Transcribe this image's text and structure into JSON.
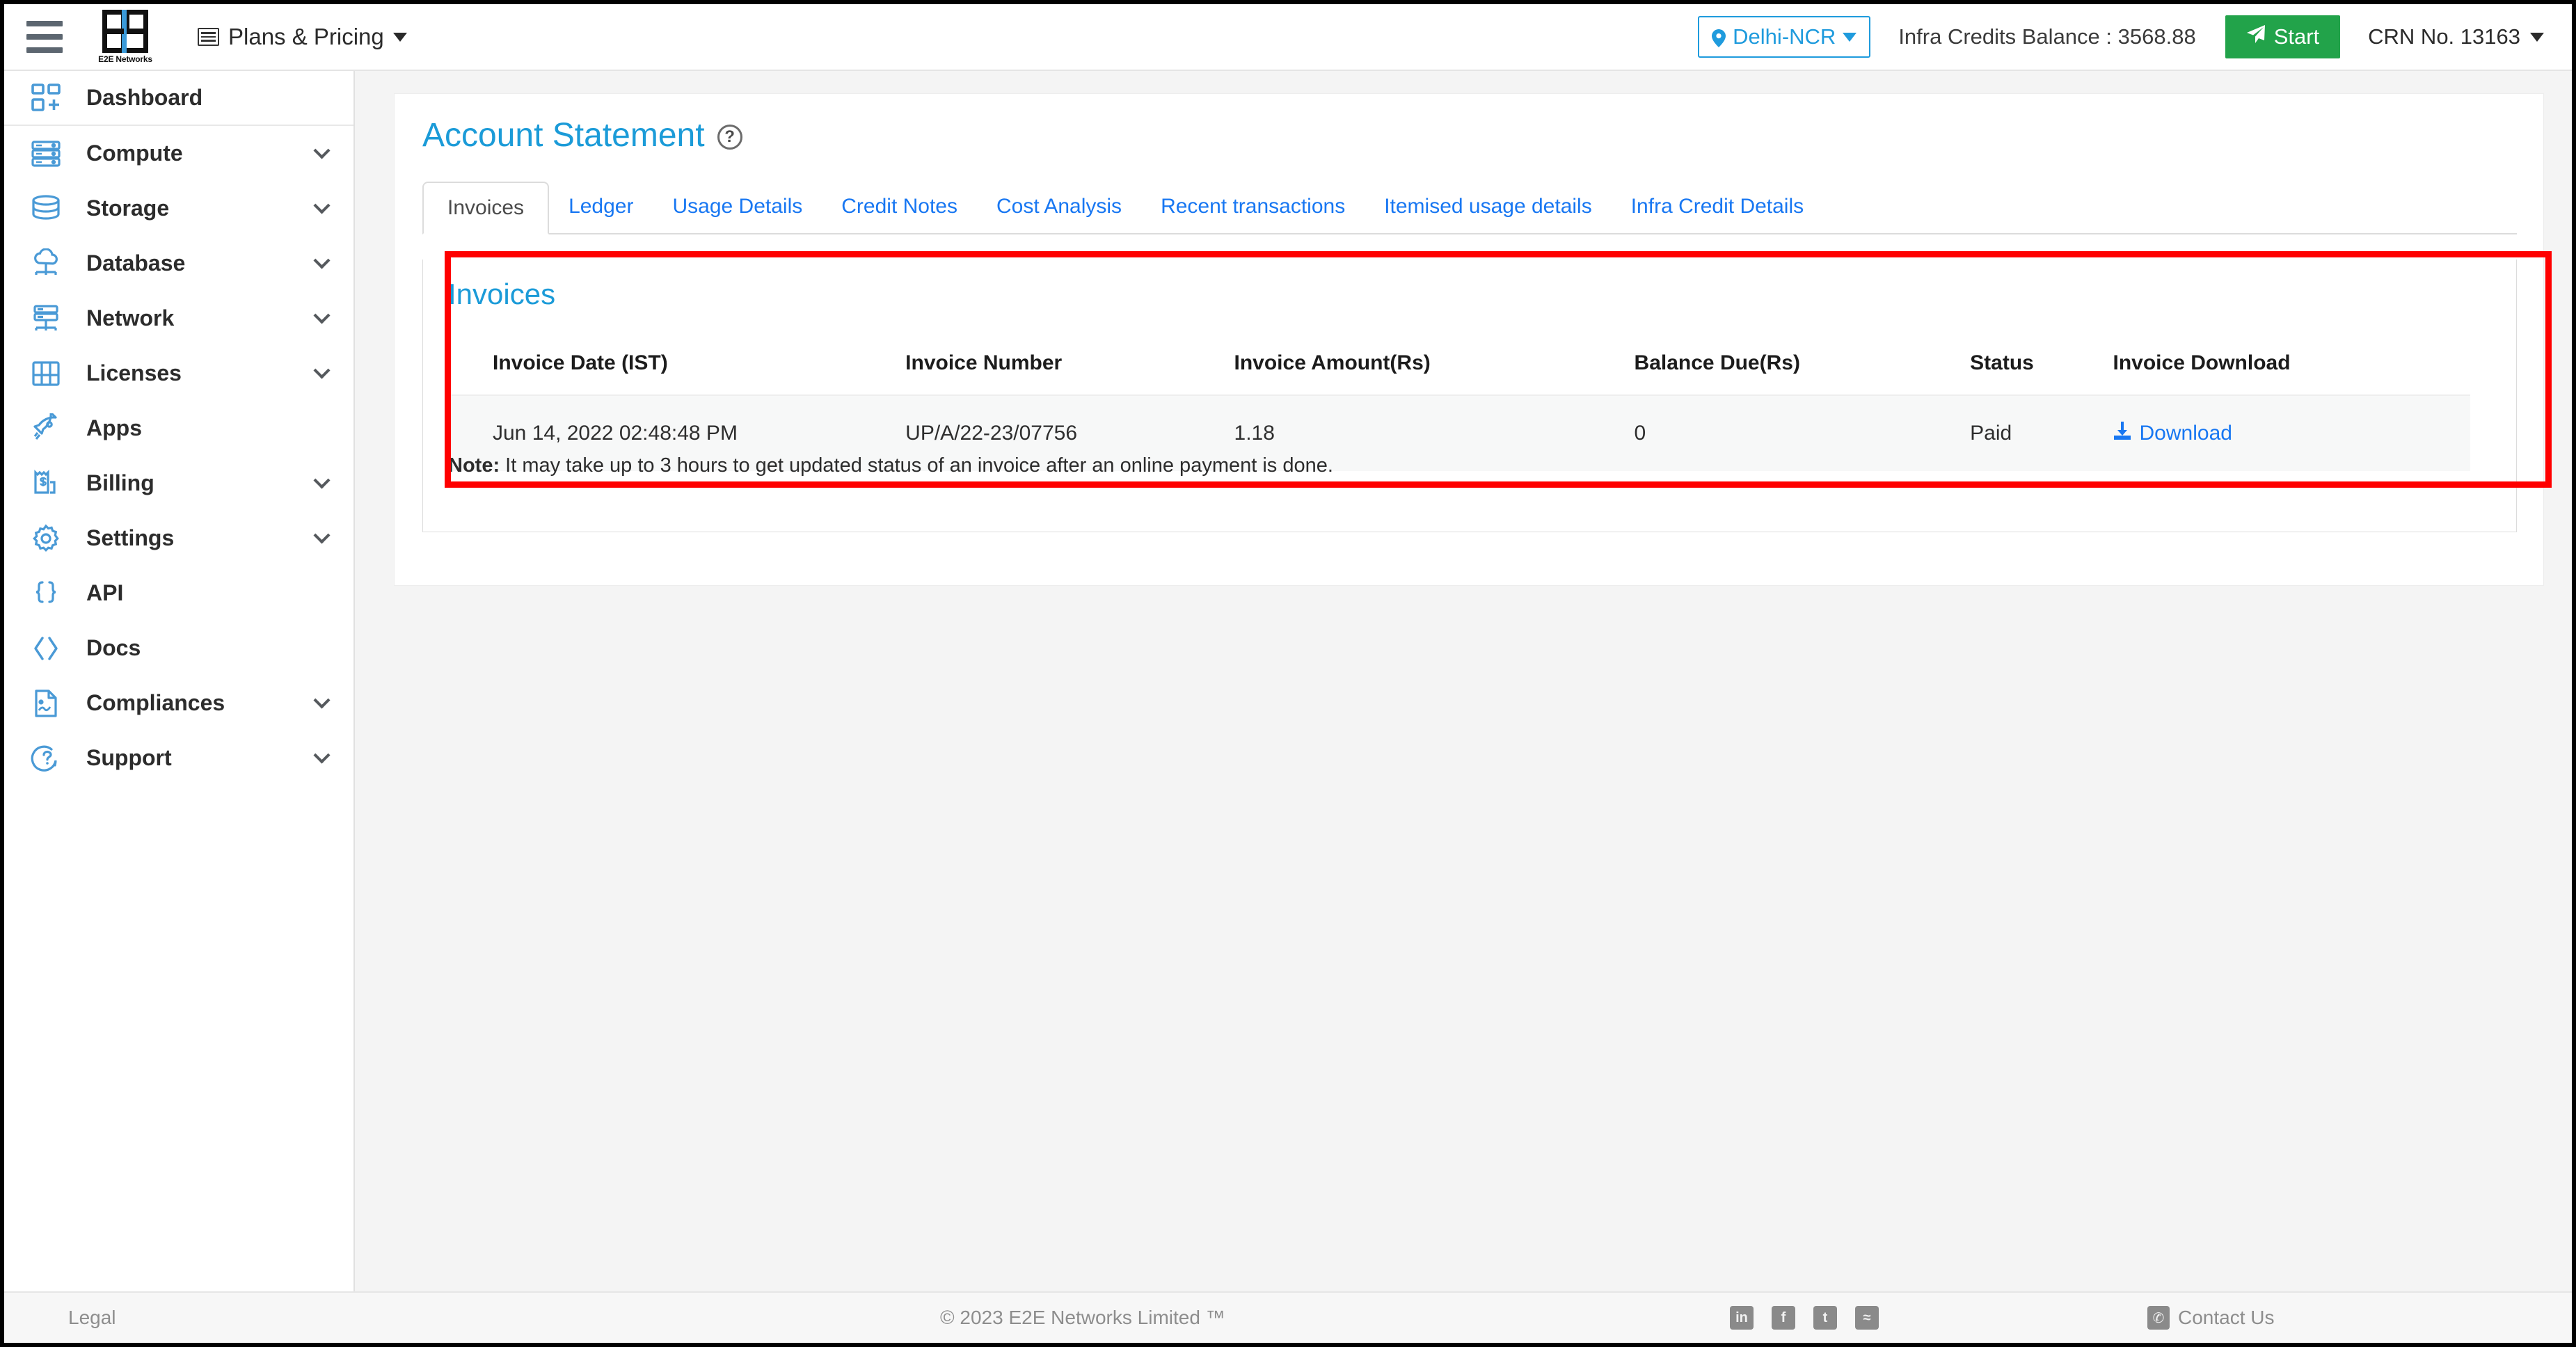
{
  "topbar": {
    "menu_icon": "hamburger-icon",
    "logo_text": "E2E Networks",
    "plans_label": "Plans & Pricing",
    "region_label": "Delhi-NCR",
    "credits_label": "Infra Credits Balance : 3568.88",
    "start_label": "Start",
    "crn_label": "CRN No. 13163"
  },
  "sidebar": {
    "items": [
      {
        "label": "Dashboard",
        "icon": "dashboard-icon",
        "chevron": false
      },
      {
        "label": "Compute",
        "icon": "server-icon",
        "chevron": true
      },
      {
        "label": "Storage",
        "icon": "database-disk-icon",
        "chevron": true
      },
      {
        "label": "Database",
        "icon": "cloud-database-icon",
        "chevron": true
      },
      {
        "label": "Network",
        "icon": "network-icon",
        "chevron": true
      },
      {
        "label": "Licenses",
        "icon": "license-grid-icon",
        "chevron": true
      },
      {
        "label": "Apps",
        "icon": "rocket-icon",
        "chevron": false
      },
      {
        "label": "Billing",
        "icon": "invoice-dollar-icon",
        "chevron": true
      },
      {
        "label": "Settings",
        "icon": "gear-icon",
        "chevron": true
      },
      {
        "label": "API",
        "icon": "braces-icon",
        "chevron": false
      },
      {
        "label": "Docs",
        "icon": "code-brackets-icon",
        "chevron": false
      },
      {
        "label": "Compliances",
        "icon": "document-icon",
        "chevron": true
      },
      {
        "label": "Support",
        "icon": "support-chat-icon",
        "chevron": true
      }
    ]
  },
  "page": {
    "title": "Account Statement",
    "help_icon": "question-circle-icon",
    "tabs": [
      {
        "label": "Invoices",
        "active": true
      },
      {
        "label": "Ledger",
        "active": false
      },
      {
        "label": "Usage Details",
        "active": false
      },
      {
        "label": "Credit Notes",
        "active": false
      },
      {
        "label": "Cost Analysis",
        "active": false
      },
      {
        "label": "Recent transactions",
        "active": false
      },
      {
        "label": "Itemised usage details",
        "active": false
      },
      {
        "label": "Infra Credit Details",
        "active": false
      }
    ]
  },
  "invoices": {
    "panel_title": "Invoices",
    "columns": [
      "Invoice Date (IST)",
      "Invoice Number",
      "Invoice Amount(Rs)",
      "Balance Due(Rs)",
      "Status",
      "Invoice Download"
    ],
    "rows": [
      {
        "date": "Jun 14, 2022 02:48:48 PM",
        "number": "UP/A/22-23/07756",
        "amount": "1.18",
        "balance_due": "0",
        "status": "Paid",
        "download_label": "Download"
      }
    ],
    "note_label": "Note:",
    "note_text": " It may take up to 3 hours to get updated status of an invoice after an online payment is done."
  },
  "highlight": {
    "color": "#ff0000"
  },
  "footer": {
    "legal": "Legal",
    "copyright": "© 2023 E2E Networks Limited ™",
    "social": [
      {
        "name": "linkedin-icon",
        "glyph": "in"
      },
      {
        "name": "facebook-icon",
        "glyph": "f"
      },
      {
        "name": "twitter-icon",
        "glyph": "t"
      },
      {
        "name": "rss-icon",
        "glyph": "≈"
      }
    ],
    "contact": "Contact Us"
  },
  "colors": {
    "accent": "#1b9bd8",
    "link": "#1877f2",
    "success": "#22a34a",
    "highlight": "#ff0000"
  }
}
